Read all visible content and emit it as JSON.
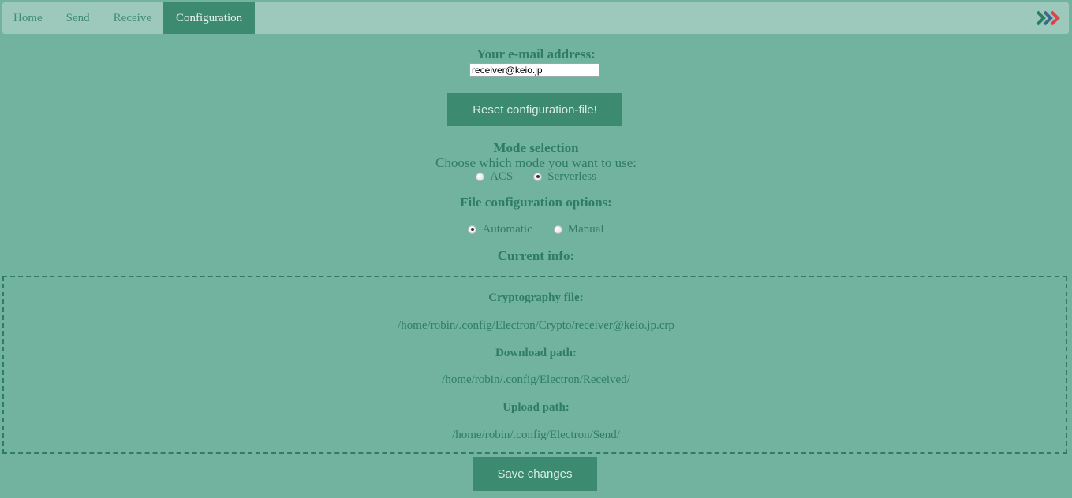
{
  "nav": {
    "tabs": [
      {
        "label": "Home",
        "active": false
      },
      {
        "label": "Send",
        "active": false
      },
      {
        "label": "Receive",
        "active": false
      },
      {
        "label": "Configuration",
        "active": true
      }
    ],
    "arrows_icon": "triple-chevron-right-icon",
    "arrow_colors": [
      "#2e7d62",
      "#3a6b8c",
      "#e0424b"
    ]
  },
  "email": {
    "label": "Your e-mail address:",
    "value": "receiver@keio.jp"
  },
  "reset_button": "Reset configuration-file!",
  "mode": {
    "title": "Mode selection",
    "subtitle": "Choose which mode you want to use:",
    "options": [
      {
        "label": "ACS",
        "checked": false
      },
      {
        "label": "Serverless",
        "checked": true
      }
    ]
  },
  "file_config": {
    "title": "File configuration options:",
    "options": [
      {
        "label": "Automatic",
        "checked": true
      },
      {
        "label": "Manual",
        "checked": false
      }
    ]
  },
  "current_info": {
    "title": "Current info:",
    "crypto_label": "Cryptography file:",
    "crypto_path": "/home/robin/.config/Electron/Crypto/receiver@keio.jp.crp",
    "download_label": "Download path:",
    "download_path": "/home/robin/.config/Electron/Received/",
    "upload_label": "Upload path:",
    "upload_path": "/home/robin/.config/Electron/Send/"
  },
  "save_button": "Save changes",
  "colors": {
    "background": "#72b39f",
    "navbar": "#9cc9bb",
    "accent": "#3c8a6f",
    "text": "#2e7d62"
  }
}
